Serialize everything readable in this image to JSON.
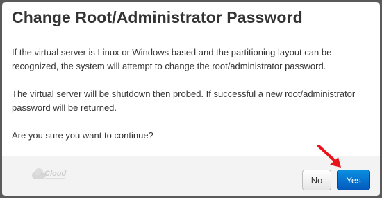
{
  "dialog": {
    "title": "Change Root/Administrator Password",
    "paragraphs": [
      "If the virtual server is Linux or Windows based and the partitioning layout can be recognized, the system will attempt to change the root/administrator password.",
      "The virtual server will be shutdown then probed. If successful a new root/administrator password will be returned.",
      "Are you sure you want to continue?"
    ],
    "buttons": {
      "no": "No",
      "yes": "Yes"
    }
  },
  "footer": {
    "logo_text": "Cloud"
  },
  "colors": {
    "primary_button": "#0a6fd4",
    "annotation_arrow": "#e8141a",
    "backdrop": "#5a5a5a"
  },
  "icons": [
    "cloud-logo-icon",
    "red-arrow-annotation-icon"
  ]
}
